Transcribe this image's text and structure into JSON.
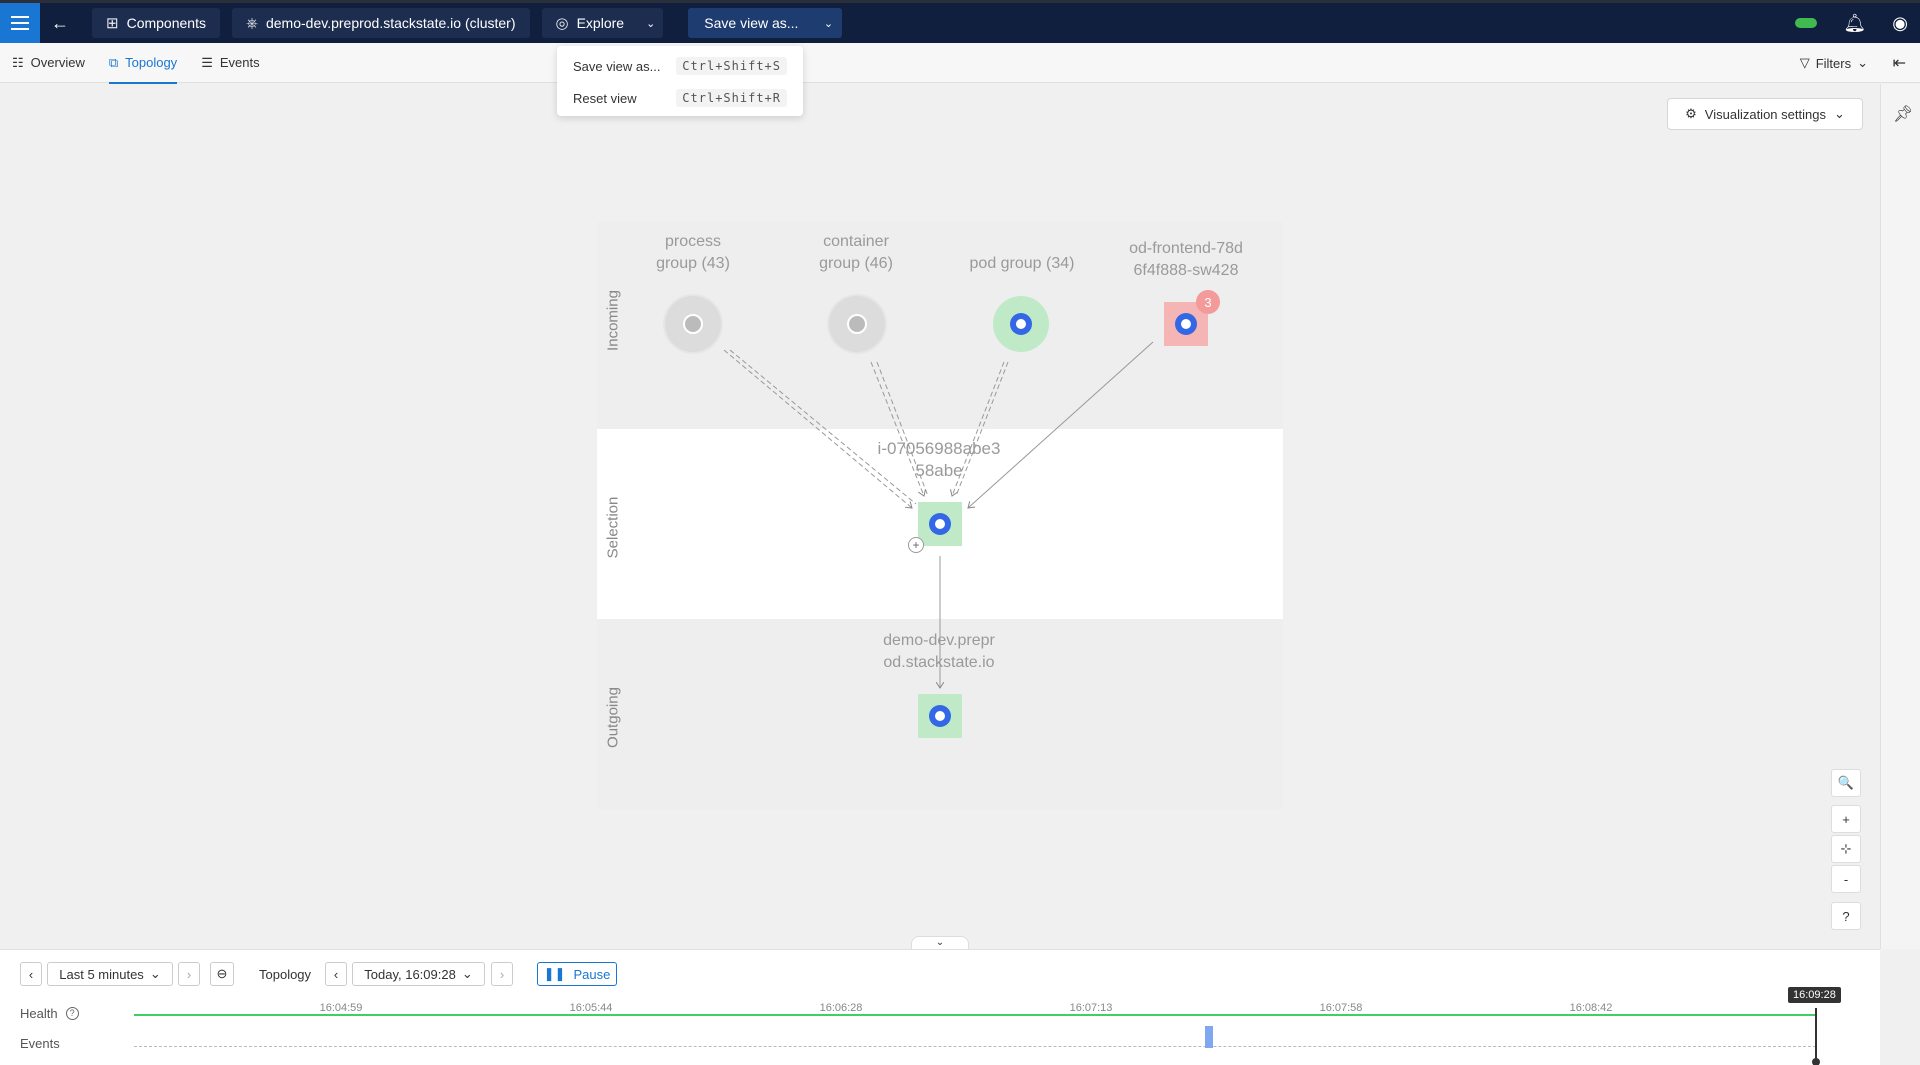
{
  "topbar": {
    "breadcrumbs": [
      {
        "label": "Components",
        "icon": "grid-icon"
      },
      {
        "label": "demo-dev.preprod.stackstate.io (cluster)",
        "icon": "kubernetes-icon"
      },
      {
        "label": "Explore",
        "icon": "compass-icon"
      }
    ],
    "save_view_label": "Save view as..."
  },
  "tabs": [
    {
      "label": "Overview",
      "icon": "list-icon",
      "active": false
    },
    {
      "label": "Topology",
      "icon": "topology-icon",
      "active": true
    },
    {
      "label": "Events",
      "icon": "events-icon",
      "active": false
    }
  ],
  "filters_label": "Filters",
  "menu": {
    "items": [
      {
        "label": "Save view as...",
        "shortcut": "Ctrl+Shift+S"
      },
      {
        "label": "Reset view",
        "shortcut": "Ctrl+Shift+R"
      }
    ]
  },
  "visualization_settings_label": "Visualization settings",
  "lanes": {
    "incoming": "Incoming",
    "selection": "Selection",
    "outgoing": "Outgoing"
  },
  "nodes": {
    "process": {
      "line1": "process",
      "line2": "group (43)"
    },
    "container": {
      "line1": "container",
      "line2": "group (46)"
    },
    "pod": {
      "line1": "pod group (34)"
    },
    "frontend": {
      "line1": "od-frontend-78d",
      "line2": "6f4f888-sw428",
      "badge": "3"
    },
    "selected": {
      "line1": "i-07056988abe3",
      "line2": "58abe"
    },
    "cluster": {
      "line1": "demo-dev.prepr",
      "line2": "od.stackstate.io"
    }
  },
  "zoom": {
    "search": "🔍",
    "zoom_in": "+",
    "fit": "⊹",
    "zoom_out": "-",
    "help": "?"
  },
  "timeline": {
    "range_label": "Last 5 minutes",
    "mode_label": "Topology",
    "time_label": "Today, 16:09:28",
    "pause_label": "Pause",
    "health_label": "Health",
    "events_label": "Events",
    "ticks": [
      "16:04:59",
      "16:05:44",
      "16:06:28",
      "16:07:13",
      "16:07:58",
      "16:08:42"
    ],
    "cursor_time": "16:09:28"
  },
  "colors": {
    "topbar": "#0f1f3d",
    "accent": "#1976d2",
    "health": "#3fcf63",
    "node_green": "#bfe9c7",
    "node_red": "#f5b5b5"
  }
}
